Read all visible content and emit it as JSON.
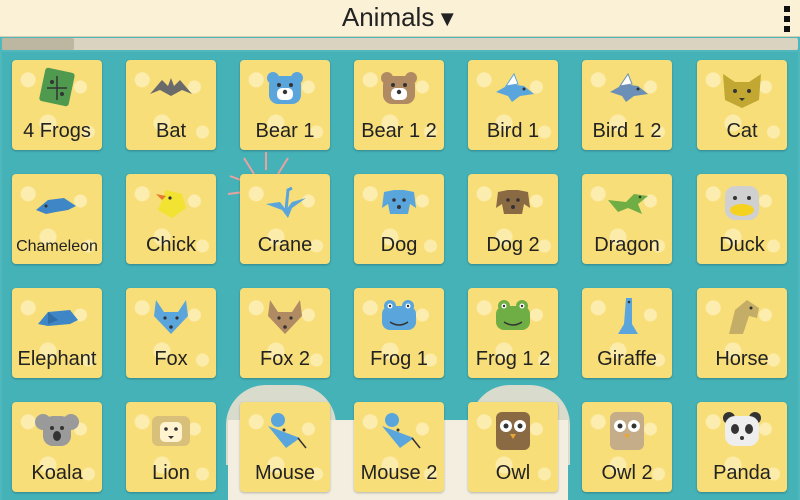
{
  "header": {
    "title": "Animals",
    "arrow": "▼"
  },
  "tiles": [
    {
      "label": "4 Frogs",
      "icon": "four-frogs-icon",
      "color": "#4f9a4f"
    },
    {
      "label": "Bat",
      "icon": "bat-icon",
      "color": "#6a6a6a"
    },
    {
      "label": "Bear 1",
      "icon": "bear-icon",
      "color": "#5aa6dc"
    },
    {
      "label": "Bear 1 2",
      "icon": "bear-icon",
      "color": "#b08a62"
    },
    {
      "label": "Bird 1",
      "icon": "bird-icon",
      "color": "#5aa6dc"
    },
    {
      "label": "Bird 1 2",
      "icon": "bird-icon",
      "color": "#6b8fb6"
    },
    {
      "label": "Cat",
      "icon": "cat-icon",
      "color": "#c2a833"
    },
    {
      "label": "Chameleon",
      "icon": "chameleon-icon",
      "color": "#3f86c6"
    },
    {
      "label": "Chick",
      "icon": "chick-icon",
      "color": "#f2e232"
    },
    {
      "label": "Crane",
      "icon": "crane-icon",
      "color": "#5aa6dc"
    },
    {
      "label": "Dog",
      "icon": "dog-icon",
      "color": "#5aa6dc"
    },
    {
      "label": "Dog 2",
      "icon": "dog-icon",
      "color": "#8a6a42"
    },
    {
      "label": "Dragon",
      "icon": "dragon-icon",
      "color": "#6fae45"
    },
    {
      "label": "Duck",
      "icon": "duck-icon",
      "color": "#d0d0d0"
    },
    {
      "label": "Elephant",
      "icon": "elephant-icon",
      "color": "#3f86c6"
    },
    {
      "label": "Fox",
      "icon": "fox-icon",
      "color": "#5aa6dc"
    },
    {
      "label": "Fox 2",
      "icon": "fox-icon",
      "color": "#b08a62"
    },
    {
      "label": "Frog 1",
      "icon": "frog-icon",
      "color": "#5aa6dc"
    },
    {
      "label": "Frog 1 2",
      "icon": "frog-icon",
      "color": "#6fae45"
    },
    {
      "label": "Giraffe",
      "icon": "giraffe-icon",
      "color": "#5aa6dc"
    },
    {
      "label": "Horse",
      "icon": "horse-icon",
      "color": "#c4ad66"
    },
    {
      "label": "Koala",
      "icon": "koala-icon",
      "color": "#9a9a9a"
    },
    {
      "label": "Lion",
      "icon": "lion-icon",
      "color": "#d8c07a"
    },
    {
      "label": "Mouse",
      "icon": "mouse-icon",
      "color": "#5aa6dc"
    },
    {
      "label": "Mouse 2",
      "icon": "mouse-icon",
      "color": "#5aa6dc"
    },
    {
      "label": "Owl",
      "icon": "owl-icon",
      "color": "#8a6a42"
    },
    {
      "label": "Owl 2",
      "icon": "owl-icon",
      "color": "#c4ad88"
    },
    {
      "label": "Panda",
      "icon": "panda-icon",
      "color": "#b8b8b8"
    }
  ]
}
